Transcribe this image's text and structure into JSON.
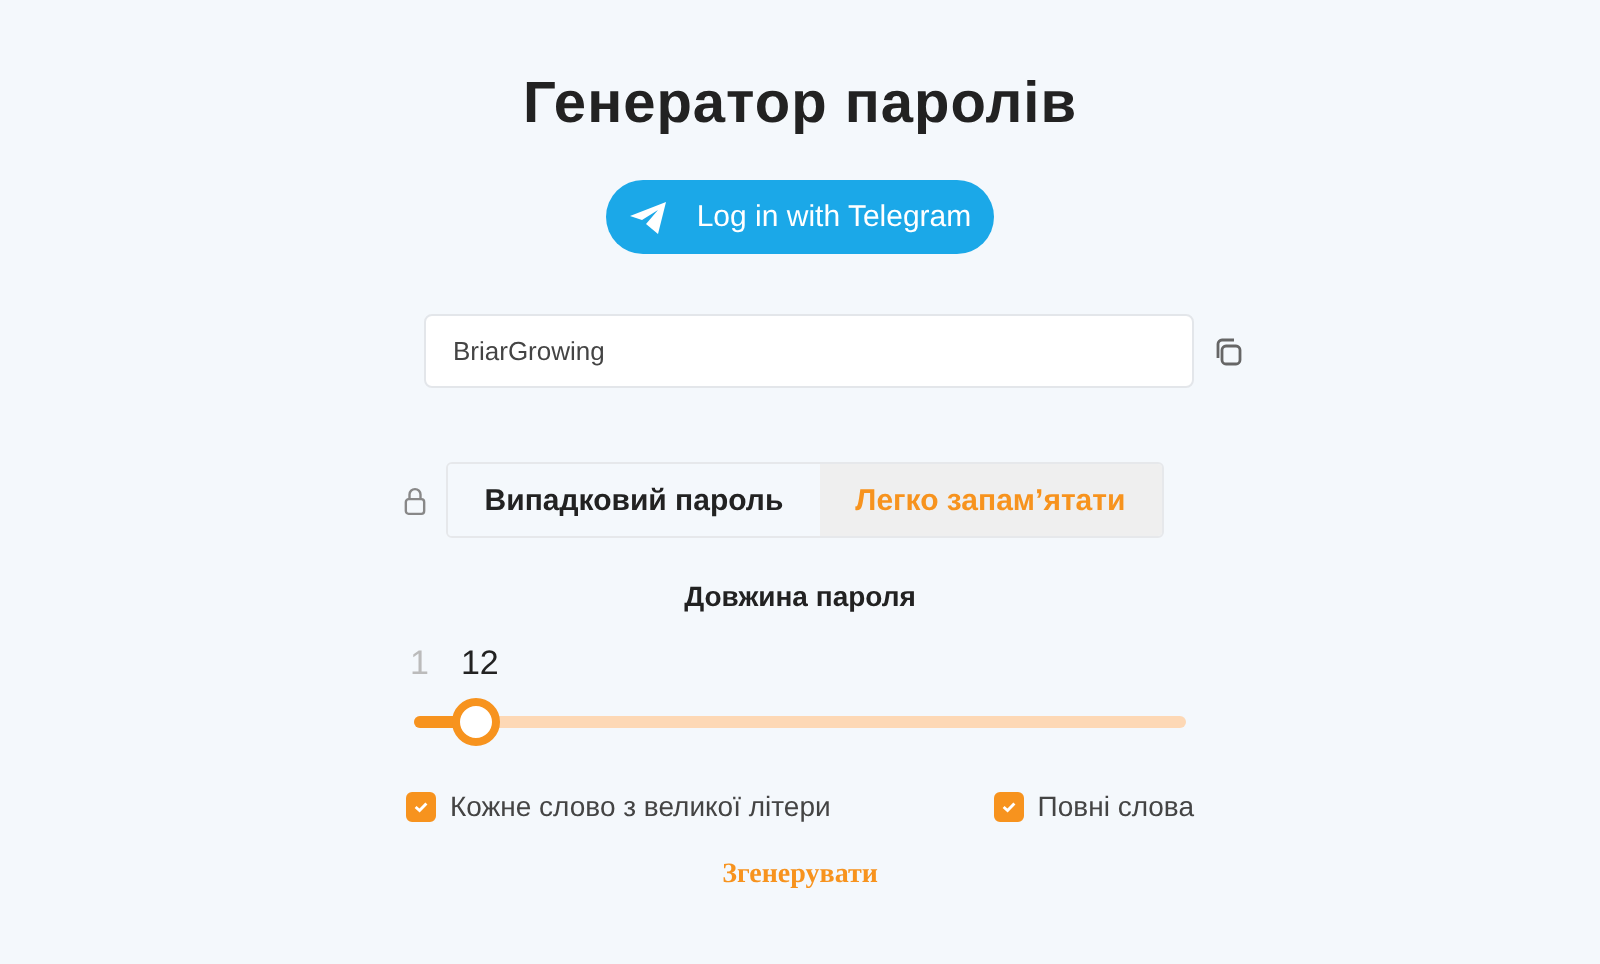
{
  "title": "Генератор паролів",
  "telegram_button": {
    "label": "Log in with Telegram"
  },
  "password_field": {
    "value": "BriarGrowing"
  },
  "tabs": [
    {
      "label": "Випадковий пароль",
      "selected": false
    },
    {
      "label": "Легко запам’ятати",
      "selected": true
    }
  ],
  "length": {
    "label": "Довжина пароля",
    "min": "1",
    "value": "12",
    "level": 0.08
  },
  "options": [
    {
      "label": "Кожне слово з великої літери",
      "checked": true
    },
    {
      "label": "Повні слова",
      "checked": true
    }
  ],
  "generate_button": {
    "label": "Згенерувати"
  }
}
